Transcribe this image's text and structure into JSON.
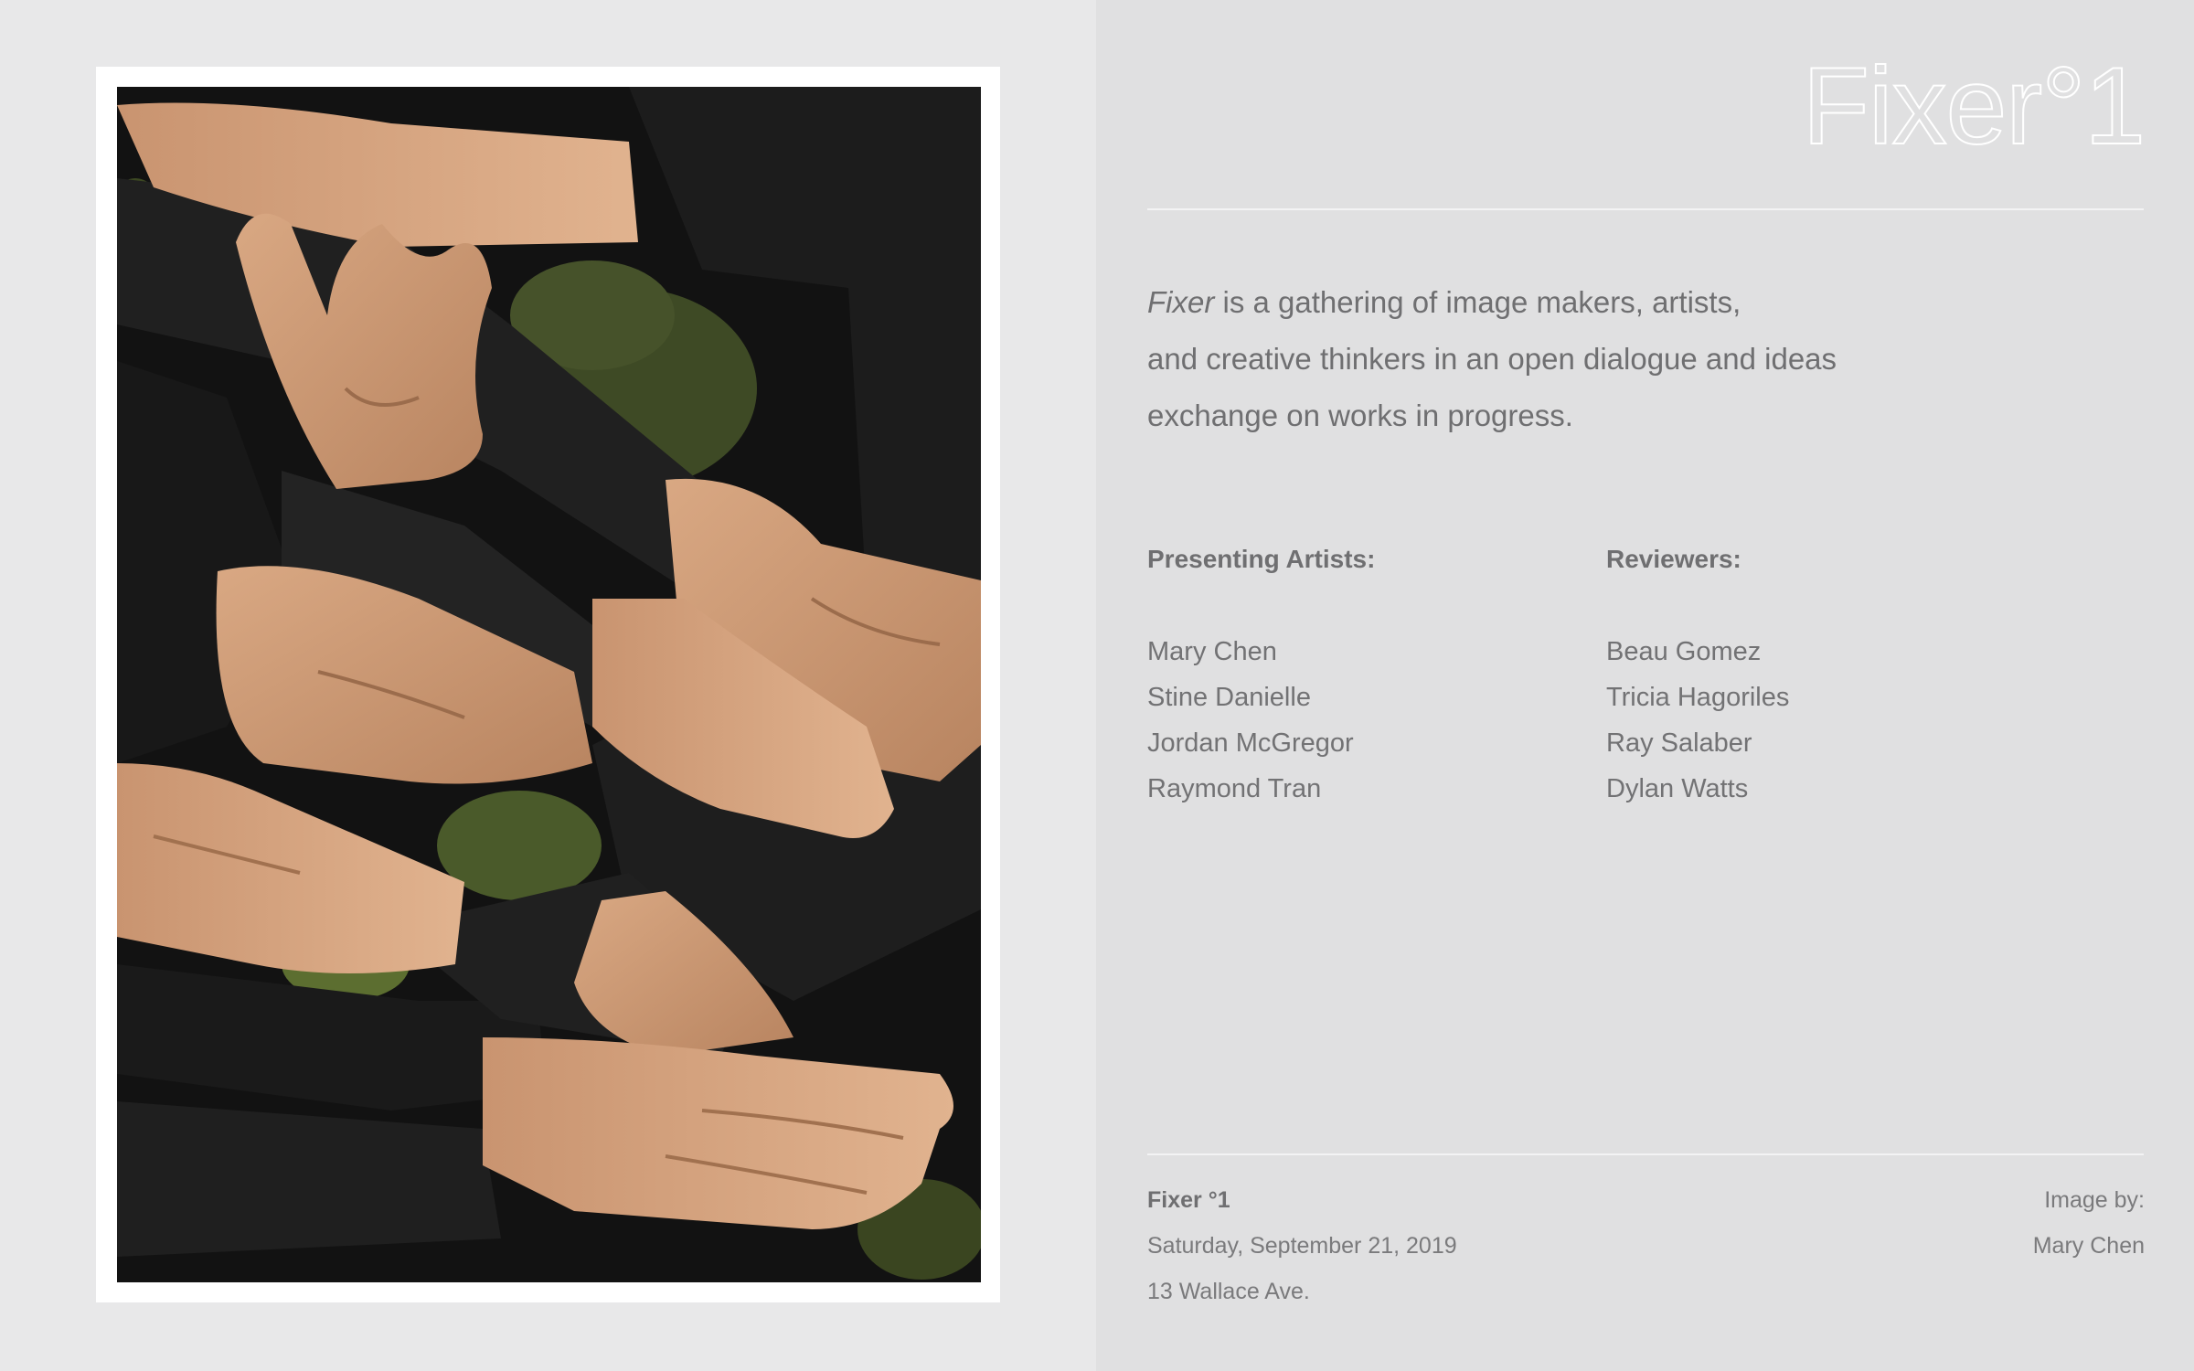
{
  "logo": "Fixer°1",
  "intro": {
    "emphasis": "Fixer",
    "line1_rest": " is a gathering of image makers, artists,",
    "line2": "and creative thinkers in an open dialogue and ideas",
    "line3": "exchange on works in progress."
  },
  "presenting": {
    "heading": "Presenting Artists:",
    "names": [
      "Mary Chen",
      "Stine Danielle",
      "Jordan McGregor",
      "Raymond Tran"
    ]
  },
  "reviewers": {
    "heading": "Reviewers:",
    "names": [
      "Beau Gomez",
      "Tricia Hagoriles",
      "Ray Salaber",
      "Dylan Watts"
    ]
  },
  "footer": {
    "title": "Fixer °1",
    "date": "Saturday, September 21, 2019",
    "address": "13 Wallace Ave.",
    "credit_label": "Image by:",
    "credit_name": "Mary Chen"
  },
  "colors": {
    "left_background": "#e8e8e9",
    "right_background": "#e0e0e1",
    "text": "#6f6f71",
    "rule": "#f3f3f4"
  },
  "photo": {
    "subject": "interlocked-hands-photo"
  }
}
